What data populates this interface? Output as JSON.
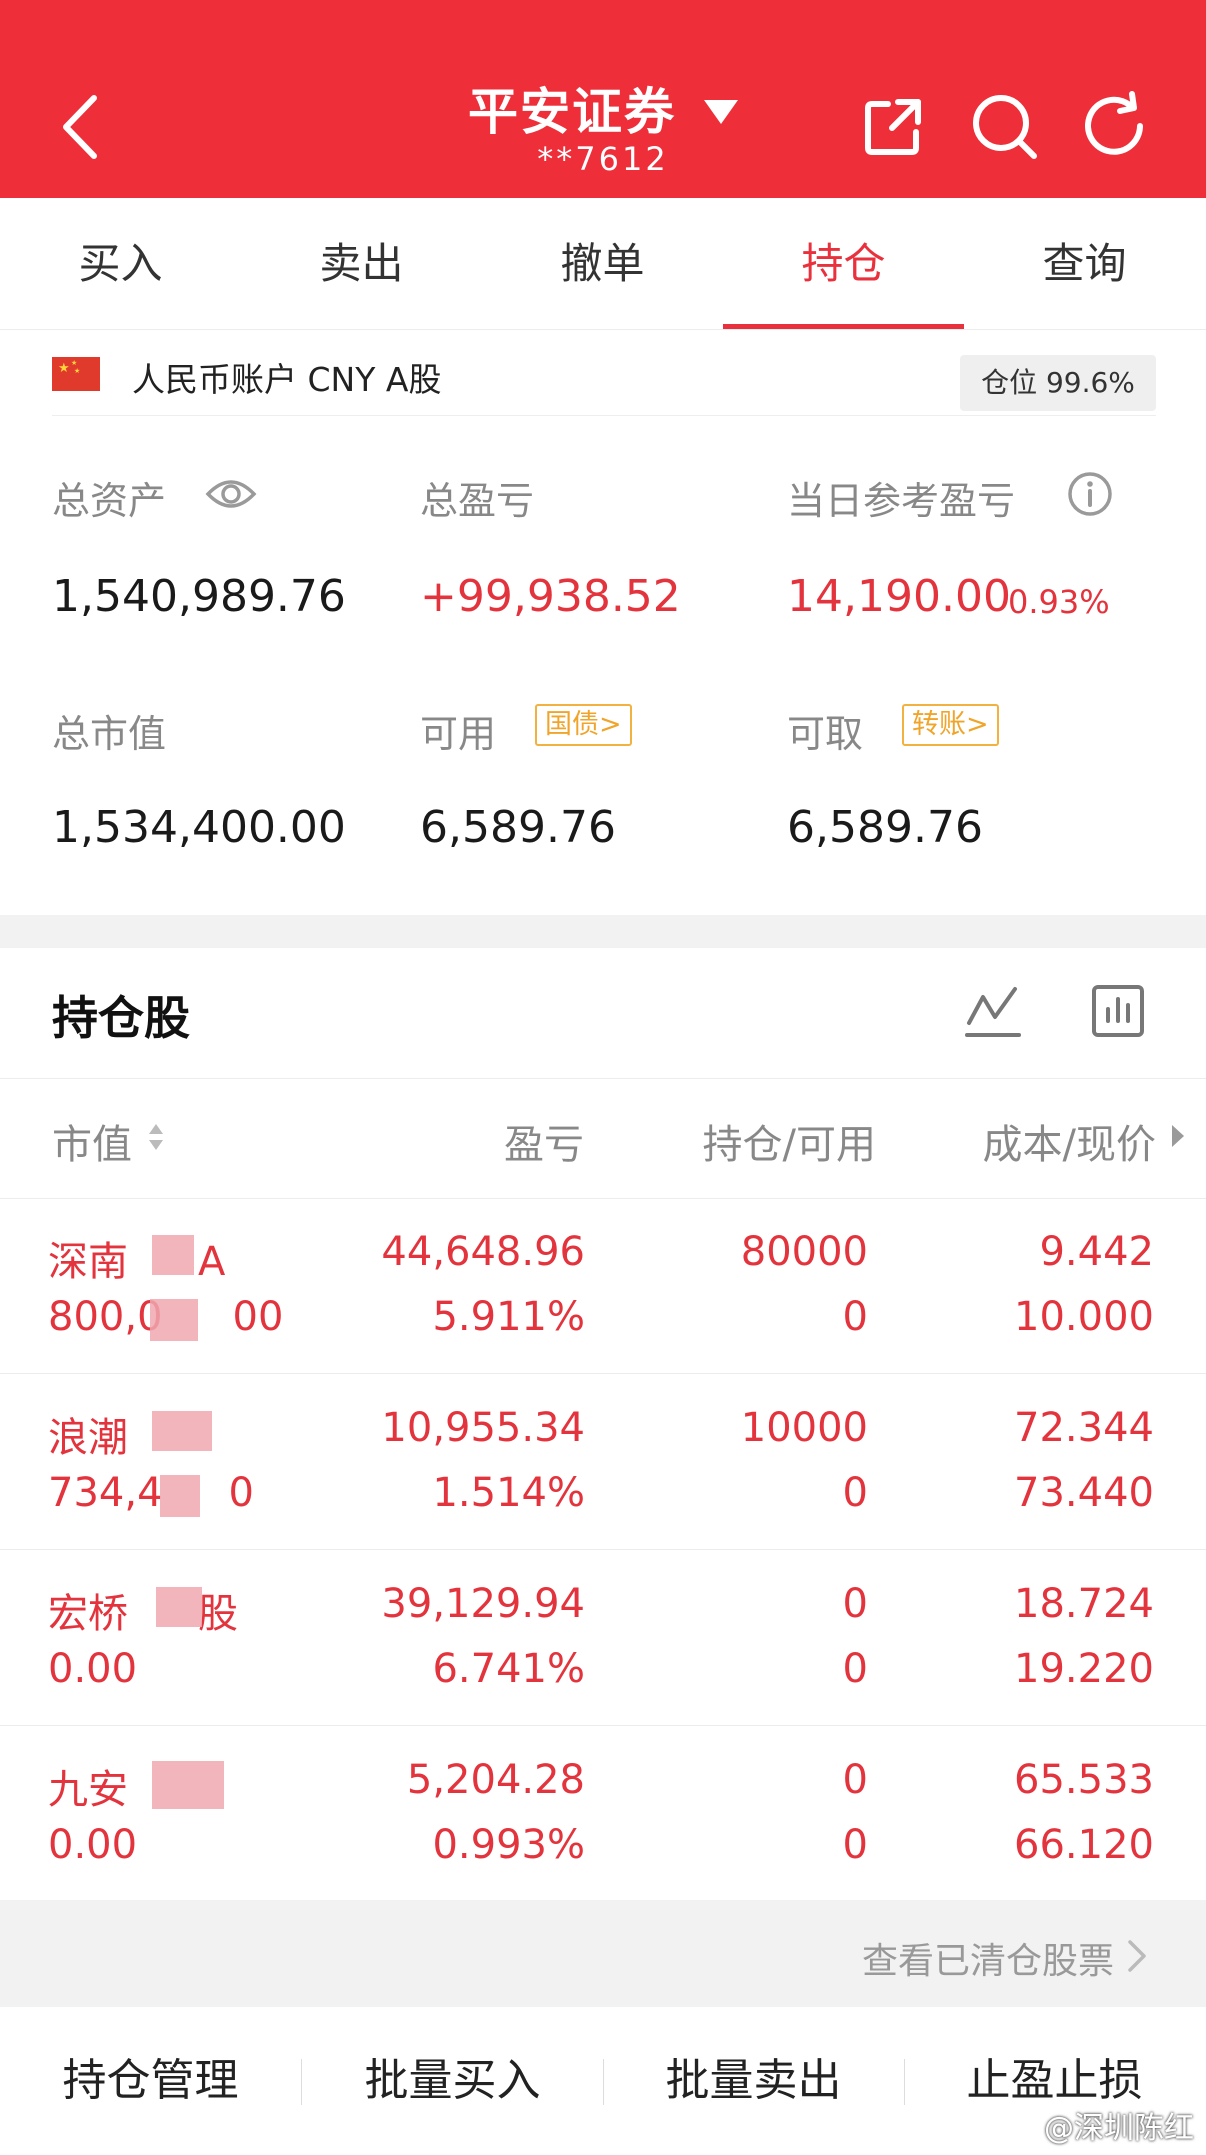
{
  "header": {
    "title": "平安证券",
    "account": "**7612",
    "icons": [
      "back-arrow-icon",
      "dropdown-caret-icon",
      "share-icon",
      "search-icon",
      "refresh-icon"
    ],
    "bg_color": "#ee2f3a"
  },
  "tabs": [
    {
      "label": "买入"
    },
    {
      "label": "卖出"
    },
    {
      "label": "撤单"
    },
    {
      "label": "持仓",
      "active": true
    },
    {
      "label": "查询"
    }
  ],
  "account_bar": {
    "account_type": "人民币账户 CNY A股",
    "position_label": "仓位 99.6%"
  },
  "summary": {
    "total_assets_label": "总资产",
    "total_assets": "1,540,989.76",
    "total_pnl_label": "总盈亏",
    "total_pnl": "+99,938.52",
    "daily_pnl_label": "当日参考盈亏",
    "daily_pnl": "14,190.00",
    "daily_pnl_pct": "0.93%",
    "market_value_label": "总市值",
    "market_value": "1,534,400.00",
    "available_label": "可用",
    "available_tag": "国债>",
    "available": "6,589.76",
    "withdrawable_label": "可取",
    "withdrawable_tag": "转账>",
    "withdrawable": "6,589.76"
  },
  "holdings": {
    "title": "持仓股",
    "columns": [
      "市值",
      "盈亏",
      "持仓/可用",
      "成本/现价"
    ],
    "rows": [
      {
        "name": "深南",
        "name_tail": "A",
        "market_value": "800,0",
        "mv_tail": "00",
        "pnl": "44,648.96",
        "pnl_pct": "5.911%",
        "position": "80000",
        "available": "0",
        "cost": "9.442",
        "price": "10.000"
      },
      {
        "name": "浪潮",
        "name_tail": "",
        "market_value": "734,4",
        "mv_tail": "0",
        "pnl": "10,955.34",
        "pnl_pct": "1.514%",
        "position": "10000",
        "available": "0",
        "cost": "72.344",
        "price": "73.440"
      },
      {
        "name": "宏桥",
        "name_tail": "股",
        "market_value": "0.00",
        "mv_tail": "",
        "pnl": "39,129.94",
        "pnl_pct": "6.741%",
        "position": "0",
        "available": "0",
        "cost": "18.724",
        "price": "19.220"
      },
      {
        "name": "九安",
        "name_tail": "",
        "market_value": "0.00",
        "mv_tail": "",
        "pnl": "5,204.28",
        "pnl_pct": "0.993%",
        "position": "0",
        "available": "0",
        "cost": "65.533",
        "price": "66.120"
      }
    ],
    "cleared_link": "查看已清仓股票"
  },
  "bottom_bar": [
    "持仓管理",
    "批量买入",
    "批量卖出",
    "止盈止损"
  ],
  "watermark": "@深圳陈红",
  "colors": {
    "accent": "#ee2f3a",
    "profit": "#e3343d",
    "tag": "#f0a52a"
  }
}
